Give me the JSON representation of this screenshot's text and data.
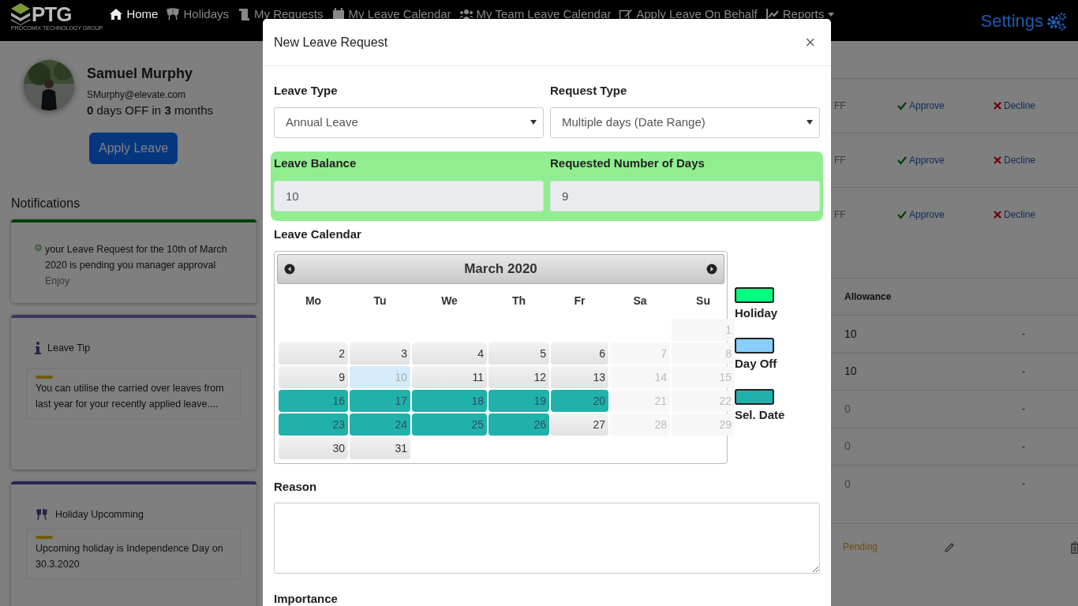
{
  "navbar": {
    "logo": "PTG",
    "logo_caption": "PROCOMIX TECHNOLOGY GROUP",
    "items": [
      {
        "label": "Home",
        "kind": "home",
        "selected": true
      },
      {
        "label": "Holidays",
        "kind": "cheers",
        "selected": false
      },
      {
        "label": "My Requests",
        "kind": "scroll",
        "selected": false
      },
      {
        "label": "My Leave Calendar",
        "kind": "calendar",
        "selected": false
      },
      {
        "label": "My Team Leave Calendar",
        "kind": "team",
        "selected": false
      },
      {
        "label": "Apply Leave On Behalf",
        "kind": "edit",
        "selected": false
      },
      {
        "label": "Reports",
        "kind": "chart",
        "selected": false
      }
    ],
    "settings": "Settings"
  },
  "profile": {
    "name": "Samuel Murphy",
    "email": "SMurphy@elevate.com",
    "summary": "**0** days OFF in **3** months",
    "apply_button": "Apply Leave"
  },
  "notifications": {
    "title": "Notifications",
    "cards": [
      {
        "kind": "greeting",
        "color": "#0a3d0a",
        "text": "your Leave Request for the 10th of March 2020 is pending you manager approval",
        "note": "Enjoy"
      },
      {
        "kind": "tip",
        "color": "#3d3560",
        "title": "Leave Tip",
        "text": "You can utilise the carried over leaves from last year for your recently applied leave...."
      },
      {
        "kind": "holiday",
        "color": "#23275a",
        "title": "Holiday Upcomming",
        "text": "Upcoming holiday is Independence Day on 30.3.2020"
      }
    ]
  },
  "approvals": [
    {
      "column_1": "FF",
      "approve": "Approve",
      "decline": "Decline"
    },
    {
      "column_1": "FF",
      "approve": "Approve",
      "decline": "Decline"
    },
    {
      "column_1": "FF",
      "approve": "Approve",
      "decline": "Decline"
    }
  ],
  "allowance_table": {
    "header": "Allowance",
    "rows": [
      {
        "allowance": "10",
        "column_2": "-",
        "muted": false
      },
      {
        "allowance": "10",
        "column_2": "-",
        "muted": false
      },
      {
        "allowance": "0",
        "column_2": "-",
        "muted": true
      },
      {
        "allowance": "0",
        "column_2": "-",
        "muted": true
      },
      {
        "allowance": "0",
        "column_2": "-",
        "muted": true
      }
    ]
  },
  "request_row": {
    "status": "Pending"
  },
  "modal": {
    "title": "New Leave Request",
    "close": "×",
    "leave_type": {
      "label": "Leave Type",
      "value": "Annual Leave"
    },
    "request_type": {
      "label": "Request Type",
      "value": "Multiple days (Date Range)"
    },
    "leave_balance": {
      "label": "Leave Balance",
      "value": "10"
    },
    "requested_days": {
      "label": "Requested Number of Days",
      "value": "9"
    },
    "calendar_label": "Leave Calendar",
    "calendar": {
      "month": "March 2020",
      "weekdays": [
        "Mo",
        "Tu",
        "We",
        "Th",
        "Fr",
        "Sa",
        "Su"
      ],
      "weeks": [
        [
          {
            "kind": "blank"
          },
          {
            "kind": "blank"
          },
          {
            "kind": "blank"
          },
          {
            "kind": "blank"
          },
          {
            "kind": "blank"
          },
          {
            "kind": "blank"
          },
          {
            "day": "1",
            "kind": "weekend"
          }
        ],
        [
          {
            "day": "2",
            "kind": "workday"
          },
          {
            "day": "3",
            "kind": "workday"
          },
          {
            "day": "4",
            "kind": "workday"
          },
          {
            "day": "5",
            "kind": "workday"
          },
          {
            "day": "6",
            "kind": "workday"
          },
          {
            "day": "7",
            "kind": "weekend"
          },
          {
            "day": "8",
            "kind": "weekend"
          }
        ],
        [
          {
            "day": "9",
            "kind": "workday"
          },
          {
            "day": "10",
            "kind": "day_off"
          },
          {
            "day": "11",
            "kind": "workday"
          },
          {
            "day": "12",
            "kind": "workday"
          },
          {
            "day": "13",
            "kind": "workday"
          },
          {
            "day": "14",
            "kind": "weekend"
          },
          {
            "day": "15",
            "kind": "weekend"
          }
        ],
        [
          {
            "day": "16",
            "kind": "selected"
          },
          {
            "day": "17",
            "kind": "selected"
          },
          {
            "day": "18",
            "kind": "selected"
          },
          {
            "day": "19",
            "kind": "selected"
          },
          {
            "day": "20",
            "kind": "selected"
          },
          {
            "day": "21",
            "kind": "weekend"
          },
          {
            "day": "22",
            "kind": "weekend"
          }
        ],
        [
          {
            "day": "23",
            "kind": "selected"
          },
          {
            "day": "24",
            "kind": "selected"
          },
          {
            "day": "25",
            "kind": "selected"
          },
          {
            "day": "26",
            "kind": "selected"
          },
          {
            "day": "27",
            "kind": "workday"
          },
          {
            "day": "28",
            "kind": "weekend"
          },
          {
            "day": "29",
            "kind": "weekend"
          }
        ],
        [
          {
            "day": "30",
            "kind": "workday"
          },
          {
            "day": "31",
            "kind": "workday"
          },
          {
            "kind": "blank"
          },
          {
            "kind": "blank"
          },
          {
            "kind": "blank"
          },
          {
            "kind": "blank"
          },
          {
            "kind": "blank"
          }
        ]
      ]
    },
    "legend": [
      {
        "label": "Holiday",
        "color": "#00ff7f"
      },
      {
        "label": "Day Off",
        "color": "#87cefa"
      },
      {
        "label": "Sel. Date",
        "color": "#20b2aa"
      }
    ],
    "reason_label": "Reason",
    "importance_label": "Importance"
  }
}
